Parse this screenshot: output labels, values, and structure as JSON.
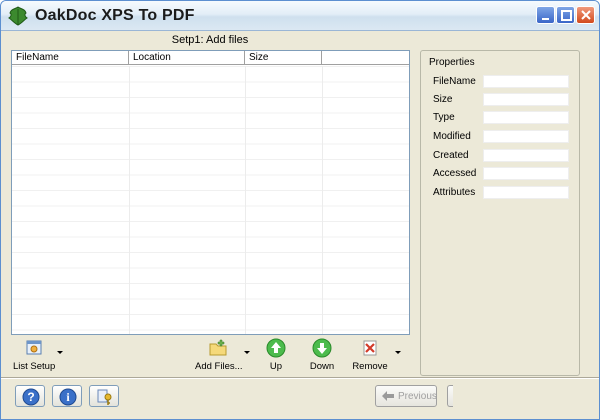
{
  "window": {
    "title": "OakDoc XPS To PDF",
    "icon": "oak-leaf-icon",
    "controls": [
      "minimize-icon",
      "maximize-icon",
      "close-icon"
    ]
  },
  "step": {
    "title": "Setp1: Add files"
  },
  "file_list": {
    "columns": [
      "FileName",
      "Location",
      "Size"
    ],
    "rows": []
  },
  "toolbar": {
    "list_setup": "List Setup",
    "add_files": "Add Files...",
    "up": "Up",
    "down": "Down",
    "remove": "Remove"
  },
  "properties": {
    "title": "Properties",
    "fields": [
      {
        "label": "FileName",
        "value": ""
      },
      {
        "label": "Size",
        "value": ""
      },
      {
        "label": "Type",
        "value": ""
      },
      {
        "label": "Modified",
        "value": ""
      },
      {
        "label": "Created",
        "value": ""
      },
      {
        "label": "Accessed",
        "value": ""
      },
      {
        "label": "Attributes",
        "value": ""
      }
    ]
  },
  "footer": {
    "help_icon": "help-icon",
    "info_icon": "info-icon",
    "register_icon": "key-icon",
    "previous": "Previous"
  },
  "colors": {
    "window_bg": "#ece9d8",
    "accent_green": "#3aa83a",
    "remove_red": "#d23a2a"
  }
}
